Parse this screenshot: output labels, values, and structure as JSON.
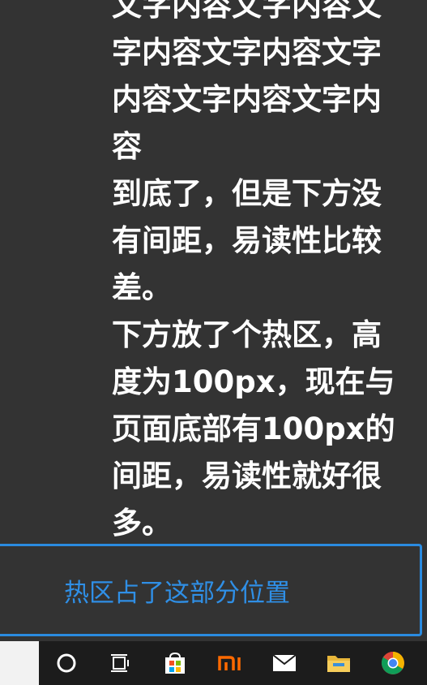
{
  "article": {
    "paragraphs": [
      "文字内容文字内容文字内容文字内容文字内容文字内容文字内容",
      "到底了，但是下方没有间距，易读性比较差。",
      "下方放了个热区，高度为100px，现在与页面底部有100px的间距，易读性就好很多。"
    ]
  },
  "hotzone": {
    "label": "热区占了这部分位置",
    "border_color": "#2a8be0",
    "text_color": "#2f8fe6"
  },
  "taskbar": {
    "icons": [
      "cortana-circle-icon",
      "task-view-icon",
      "microsoft-store-icon",
      "mi-icon",
      "mail-icon",
      "file-explorer-icon",
      "chrome-icon"
    ]
  }
}
